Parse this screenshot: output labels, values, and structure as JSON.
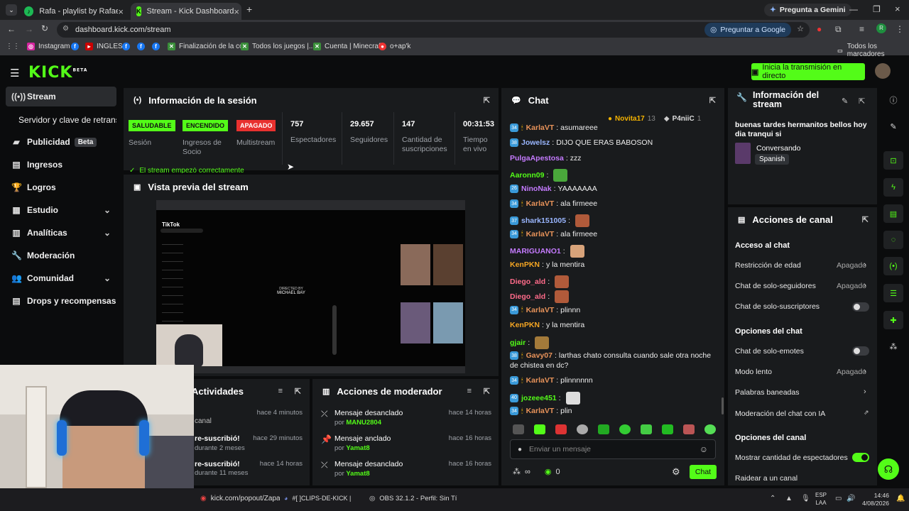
{
  "browser": {
    "tabs": [
      {
        "label": "Rafa - playlist by Rafael.xared |"
      },
      {
        "label": "Stream - Kick Dashboard"
      }
    ],
    "gemini": "Pregunta a Gemini",
    "url": "dashboard.kick.com/stream",
    "ask_google": "Preguntar a Google",
    "bookmarks": [
      "Instagram",
      "INGLES",
      "Finalización de la co...",
      "Todos los juegos |...",
      "Cuenta | Minecraft",
      "o+ap'k"
    ],
    "all_bookmarks": "Todos los marcadores"
  },
  "kick": {
    "logo": "KICK",
    "logo_beta": "BETA",
    "go_live": "Inicia la transmisión en directo",
    "sidebar": [
      {
        "label": "Stream"
      },
      {
        "label": "Servidor y clave de retransmi"
      },
      {
        "label": "Publicidad",
        "badge": "Beta"
      },
      {
        "label": "Ingresos"
      },
      {
        "label": "Logros"
      },
      {
        "label": "Estudio"
      },
      {
        "label": "Analíticas"
      },
      {
        "label": "Moderación"
      },
      {
        "label": "Comunidad"
      },
      {
        "label": "Drops y recompensas"
      }
    ],
    "session": {
      "title": "Información de la sesión",
      "stats": [
        {
          "badge": "SALUDABLE",
          "label": "Sesión",
          "color": "#53fc18"
        },
        {
          "badge": "ENCENDIDO",
          "label": "Ingresos de Socio",
          "color": "#53fc18"
        },
        {
          "badge": "APAGADO",
          "label": "Multistream",
          "color": "#e8312f"
        },
        {
          "value": "757",
          "label": "Espectadores"
        },
        {
          "value": "29.657",
          "label": "Seguidores"
        },
        {
          "value": "147",
          "label": "Cantidad de suscripciones"
        },
        {
          "value": "00:31:53",
          "label": "Tiempo en vivo"
        }
      ],
      "status": "El stream empezó correctamente"
    },
    "preview": {
      "title": "Vista previa del stream",
      "brand": "TikTok",
      "directed": "DIRECTED BY",
      "director": "MICHAEL BAY"
    },
    "activities": {
      "title": "Actividades",
      "rows": [
        {
          "text": "canal",
          "time": "hace 4 minutos"
        },
        {
          "text": "re-suscribió!",
          "sub": "durante 2 meses",
          "time": "hace 29 minutos"
        },
        {
          "text": "re-suscribió!",
          "sub": "durante 11 meses",
          "time": "hace 14 horas"
        }
      ]
    },
    "mod_actions": {
      "title": "Acciones de moderador",
      "rows": [
        {
          "action": "Mensaje desanclado",
          "by": "por",
          "user": "MANU2804",
          "time": "hace 14 horas"
        },
        {
          "action": "Mensaje anclado",
          "by": "por",
          "user": "Yamat8",
          "time": "hace 16 horas"
        },
        {
          "action": "Mensaje desanclado",
          "by": "por",
          "user": "Yamat8",
          "time": "hace 16 horas"
        }
      ]
    },
    "chat": {
      "title": "Chat",
      "top": [
        {
          "name": "Novita17",
          "count": "13"
        },
        {
          "name": "P4niiC",
          "count": "1"
        }
      ],
      "messages": [
        {
          "user": "KarlaVT",
          "text": "asumareee",
          "color": "#e8935a",
          "sub": "34"
        },
        {
          "user": "Jowelsz",
          "text": "DIJO QUE ERAS BABOSON",
          "color": "#9ab6ff",
          "sub": "38"
        },
        {
          "user": "PulgaApestosa",
          "text": "zzz",
          "color": "#c57bff"
        },
        {
          "user": "Aaronn09",
          "text": "",
          "color": "#53fc18",
          "emote": "#4aa83b"
        },
        {
          "user": "NinoNak",
          "text": "YAAAAAAA",
          "color": "#c57bff",
          "sub": "26"
        },
        {
          "user": "KarlaVT",
          "text": "ala firmeee",
          "color": "#e8935a",
          "sub": "34"
        },
        {
          "user": "shark151005",
          "text": "",
          "color": "#9ab6ff",
          "sub": "37",
          "emote": "#b05a3a"
        },
        {
          "user": "KarlaVT",
          "text": "ala firmeee",
          "color": "#e8935a",
          "sub": "34"
        },
        {
          "user": "MARIGUANO1",
          "text": "",
          "color": "#c57bff",
          "emote": "#d8a37a"
        },
        {
          "user": "KenPKN",
          "text": "y la mentira",
          "color": "#f5a623"
        },
        {
          "user": "Diego_ald",
          "text": "",
          "color": "#ff6b8a",
          "emote": "#b05a3a"
        },
        {
          "user": "Diego_ald",
          "text": "",
          "color": "#ff6b8a",
          "emote": "#b05a3a"
        },
        {
          "user": "KarlaVT",
          "text": "plinnn",
          "color": "#e8935a",
          "sub": "34"
        },
        {
          "user": "KenPKN",
          "text": "y la mentira",
          "color": "#f5a623"
        },
        {
          "user": "gjair",
          "text": "",
          "color": "#53fc18",
          "emote": "#a37a3a"
        },
        {
          "user": "Gavy07",
          "text": "larthas chato consulta cuando sale otra noche",
          "text2": "de chistea en dc?",
          "color": "#e8935a",
          "sub": "38"
        },
        {
          "user": "KarlaVT",
          "text": "plinnnnnn",
          "color": "#e8935a",
          "sub": "34"
        },
        {
          "user": "jozeee451",
          "text": "",
          "color": "#53fc18",
          "sub": "40",
          "emote": "#dddddd"
        },
        {
          "user": "KarlaVT",
          "text": "plin",
          "color": "#e8935a",
          "sub": "34"
        }
      ],
      "input_placeholder": "Enviar un mensaje",
      "points": "0",
      "send": "Chat"
    },
    "stream_info": {
      "title": "Información del stream",
      "text": "buenas tardes hermanitos bellos hoy dia tranqui si",
      "category": "Conversando",
      "language": "Spanish"
    },
    "channel": {
      "title": "Acciones de canal",
      "chat_access": "Acceso al chat",
      "age": "Restricción de edad",
      "age_val": "Apagado",
      "followers": "Chat de solo-seguidores",
      "followers_val": "Apagado",
      "subs": "Chat de solo-suscriptores",
      "chat_options": "Opciones del chat",
      "emotes": "Chat de solo-emotes",
      "slow": "Modo lento",
      "slow_val": "Apagado",
      "banned": "Palabras baneadas",
      "ai": "Moderación del chat con IA",
      "channel_options": "Opciones del canal",
      "show_viewers": "Mostrar cantidad de espectadores",
      "raid": "Raidear a un canal"
    }
  },
  "taskbar": {
    "items": [
      "kick.com/popout/Zapat",
      "#[  ]CLIPS-DE-KICK  |",
      "OBS 32.1.2 - Perfil: Sin Tí"
    ],
    "lang1": "ESP",
    "lang2": "LAA",
    "time": "14:46",
    "date": "4/08/2026"
  }
}
